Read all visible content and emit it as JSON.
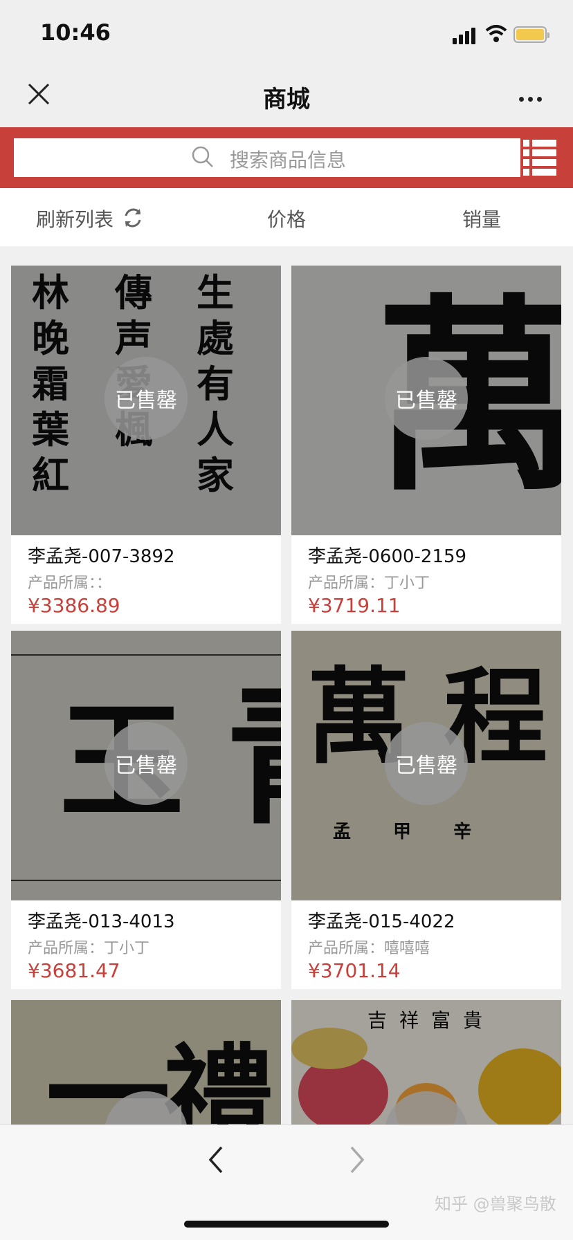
{
  "status": {
    "time": "10:46"
  },
  "navbar": {
    "title": "商城"
  },
  "search": {
    "placeholder": "搜索商品信息"
  },
  "filters": {
    "refresh_label": "刷新列表",
    "price_label": "价格",
    "sales_label": "销量"
  },
  "products": [
    {
      "name": "李孟尧-007-3892",
      "owner": "产品所属：：",
      "price": "¥3386.89",
      "badge": "已售罄"
    },
    {
      "name": "李孟尧-0600-2159",
      "owner": "产品所属：丁小丁",
      "price": "¥3719.11",
      "badge": "已售罄"
    },
    {
      "name": "李孟尧-013-4013",
      "owner": "产品所属：丁小丁",
      "price": "¥3681.47",
      "badge": "已售罄"
    },
    {
      "name": "李孟尧-015-4022",
      "owner": "产品所属：嘻嘻嘻",
      "price": "¥3701.14",
      "badge": "已售罄"
    }
  ],
  "images": {
    "img1": [
      "林晚霜葉紅",
      "傳声愛楓",
      "生處有人家"
    ],
    "img2": [
      "萬"
    ],
    "img3": [
      "玉",
      "青"
    ],
    "img4": [
      "萬",
      "程",
      "孟 甲 辛"
    ],
    "img5": [
      "一",
      "禮"
    ],
    "img6": [
      "吉祥富貴"
    ]
  },
  "watermark": "知乎 @兽聚鸟散",
  "colors": {
    "accent": "#c8403a",
    "badge_bg": "#969696",
    "price": "#c8403a"
  }
}
